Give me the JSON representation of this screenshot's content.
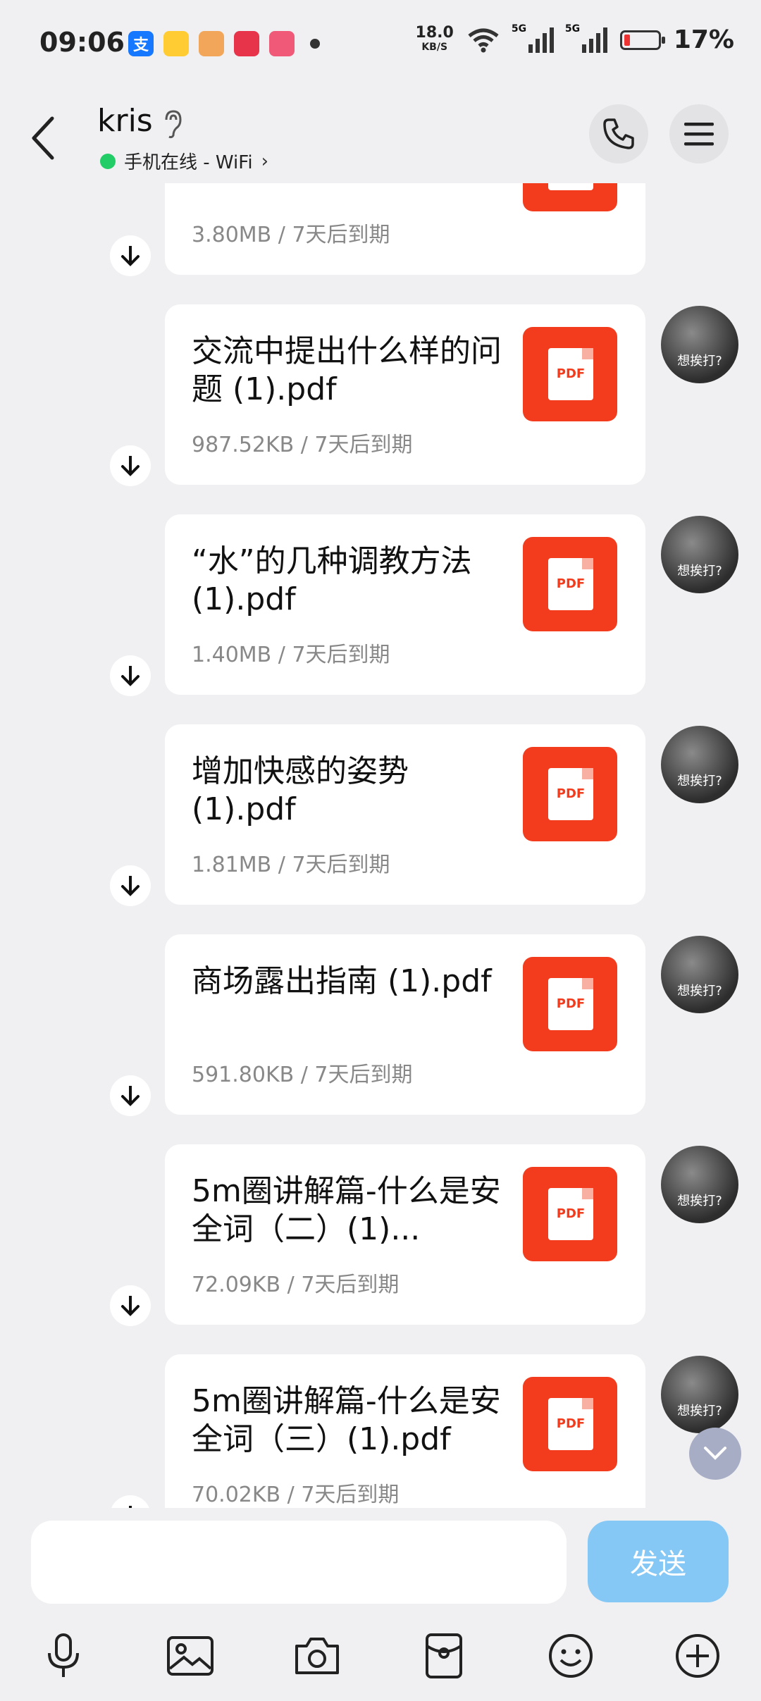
{
  "status_bar": {
    "time": "09:06",
    "net_speed": "18.0",
    "net_unit": "KB/S",
    "signal1": "5G",
    "signal2": "5G",
    "battery_percent": "17%",
    "battery_level": 0.17,
    "app_icons": [
      "alipay-icon",
      "notes-icon",
      "game-icon",
      "health-icon",
      "calendar-icon"
    ]
  },
  "header": {
    "contact_name": "kris",
    "status_text": "手机在线 - WiFi",
    "status_color": "#22cc66"
  },
  "messages": [
    {
      "file_name": "",
      "meta": "3.80MB / 7天后到期",
      "icon_label": "PDF"
    },
    {
      "file_name": "交流中提出什么样的问题 (1).pdf",
      "meta": "987.52KB / 7天后到期",
      "icon_label": "PDF"
    },
    {
      "file_name": "“水”的几种调教方法 (1).pdf",
      "meta": "1.40MB / 7天后到期",
      "icon_label": "PDF"
    },
    {
      "file_name": "增加快感的姿势 (1).pdf",
      "meta": "1.81MB / 7天后到期",
      "icon_label": "PDF"
    },
    {
      "file_name": "商场露出指南 (1).pdf",
      "meta": "591.80KB / 7天后到期",
      "icon_label": "PDF"
    },
    {
      "file_name": "5m圈讲解篇-什么是安全词（二）(1)...",
      "meta": "72.09KB / 7天后到期",
      "icon_label": "PDF"
    },
    {
      "file_name": "5m圈讲解篇-什么是安全词（三）(1).pdf",
      "meta": "70.02KB / 7天后到期",
      "icon_label": "PDF"
    }
  ],
  "avatar_text": "想挨打?",
  "composer": {
    "send_label": "发送",
    "send_color": "#86c8f5"
  },
  "toolbar_icons": [
    "microphone-icon",
    "image-icon",
    "camera-icon",
    "red-packet-icon",
    "emoji-icon",
    "plus-icon"
  ]
}
